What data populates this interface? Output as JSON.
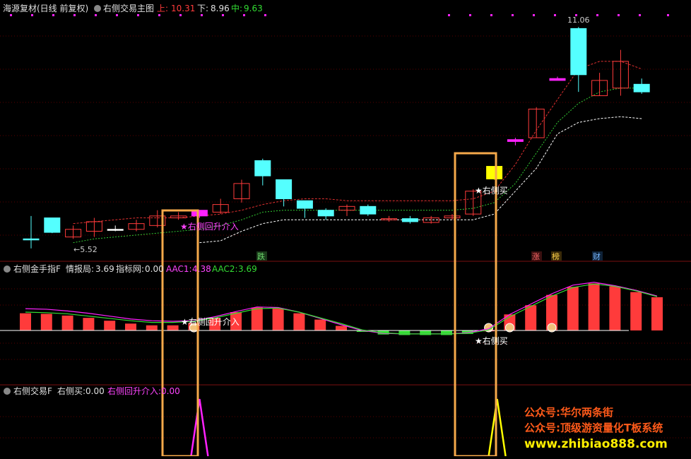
{
  "main_panel": {
    "title": "海源复材(日线 前复权)",
    "indicator_name": "右侧交易主图",
    "up_label": "上:",
    "up_value": "10.31",
    "down_label": "下:",
    "down_value": "8.96",
    "mid_label": "中:",
    "mid_value": "9.63",
    "high_marker": "11.06",
    "low_marker": "←5.52",
    "signal_buy": "★右侧买",
    "signal_rebound": "★右侧回升介入",
    "tags": [
      {
        "text": "跌",
        "color": "#6ad36a"
      },
      {
        "text": "涨",
        "color": "#ff6a6a"
      },
      {
        "text": "榜",
        "color": "#ffd24a"
      },
      {
        "text": "财",
        "color": "#7ab8ff"
      }
    ]
  },
  "panel2": {
    "title": "右侧金手指F",
    "label1": "情报局:",
    "value1": "3.69",
    "label2": "指标网:",
    "value2": "0.00",
    "label3": "AAC1:",
    "value3": "4.38",
    "label4": "AAC2:",
    "value4": "3.69",
    "signal_rebound": "★右侧回升介入",
    "signal_buy": "★右侧买"
  },
  "panel3": {
    "title": "右侧交易F",
    "label1": "右侧买:",
    "value1": "0.00",
    "label2": "右侧回升介入:",
    "value2": "0.00"
  },
  "watermark": {
    "line1": "公众号:华尔两条街",
    "line2": "公众号:顶级游资量化T板系统",
    "line3": "www.zhibiao888.com"
  },
  "colors": {
    "up": "#ff3b3b",
    "down": "#54ffff",
    "magenta": "#ff22ff",
    "yellow": "#ffff00",
    "highlight_box": "#f5a94a",
    "green_line": "#33dd33"
  },
  "chart_data": [
    {
      "type": "candlestick",
      "title": "右侧交易主图",
      "ylim": [
        5.0,
        11.4
      ],
      "candles": [
        {
          "o": 5.55,
          "h": 6.15,
          "l": 5.3,
          "c": 5.55,
          "dir": "down"
        },
        {
          "o": 6.1,
          "h": 6.1,
          "l": 5.7,
          "c": 5.72,
          "dir": "down"
        },
        {
          "o": 5.6,
          "h": 5.9,
          "l": 5.55,
          "c": 5.8,
          "dir": "up"
        },
        {
          "o": 5.75,
          "h": 6.1,
          "l": 5.6,
          "c": 6.0,
          "dir": "up"
        },
        {
          "o": 5.8,
          "h": 5.9,
          "l": 5.75,
          "c": 5.8,
          "dir": "flat"
        },
        {
          "o": 5.8,
          "h": 6.05,
          "l": 5.75,
          "c": 5.95,
          "dir": "up"
        },
        {
          "o": 5.9,
          "h": 6.3,
          "l": 5.85,
          "c": 6.15,
          "dir": "up"
        },
        {
          "o": 6.1,
          "h": 6.25,
          "l": 6.05,
          "c": 6.15,
          "dir": "up"
        },
        {
          "o": 6.3,
          "h": 6.3,
          "l": 6.1,
          "c": 6.15,
          "dir": "magenta"
        },
        {
          "o": 6.25,
          "h": 6.6,
          "l": 6.2,
          "c": 6.45,
          "dir": "up"
        },
        {
          "o": 6.6,
          "h": 7.1,
          "l": 6.5,
          "c": 7.0,
          "dir": "up"
        },
        {
          "o": 7.6,
          "h": 7.65,
          "l": 6.95,
          "c": 7.2,
          "dir": "down"
        },
        {
          "o": 7.1,
          "h": 7.1,
          "l": 6.4,
          "c": 6.6,
          "dir": "down"
        },
        {
          "o": 6.55,
          "h": 6.55,
          "l": 6.1,
          "c": 6.35,
          "dir": "down"
        },
        {
          "o": 6.3,
          "h": 6.35,
          "l": 6.05,
          "c": 6.15,
          "dir": "down"
        },
        {
          "o": 6.3,
          "h": 6.45,
          "l": 6.15,
          "c": 6.4,
          "dir": "up"
        },
        {
          "o": 6.4,
          "h": 6.45,
          "l": 6.15,
          "c": 6.2,
          "dir": "down"
        },
        {
          "o": 6.05,
          "h": 6.15,
          "l": 6.0,
          "c": 6.08,
          "dir": "up"
        },
        {
          "o": 6.08,
          "h": 6.15,
          "l": 5.95,
          "c": 6.0,
          "dir": "down"
        },
        {
          "o": 5.98,
          "h": 6.15,
          "l": 5.95,
          "c": 6.1,
          "dir": "up"
        },
        {
          "o": 6.1,
          "h": 6.2,
          "l": 6.05,
          "c": 6.15,
          "dir": "up"
        },
        {
          "o": 6.2,
          "h": 6.85,
          "l": 6.15,
          "c": 6.8,
          "dir": "up"
        },
        {
          "o": 7.12,
          "h": 7.45,
          "l": 7.1,
          "c": 7.45,
          "dir": "yellow"
        },
        {
          "o": 8.1,
          "h": 8.2,
          "l": 8.0,
          "c": 8.15,
          "dir": "magenta"
        },
        {
          "o": 8.2,
          "h": 9.0,
          "l": 8.2,
          "c": 8.95,
          "dir": "up"
        },
        {
          "o": 9.7,
          "h": 9.8,
          "l": 9.7,
          "c": 9.75,
          "dir": "magenta"
        },
        {
          "o": 11.06,
          "h": 11.1,
          "l": 9.4,
          "c": 9.85,
          "dir": "down"
        },
        {
          "o": 9.3,
          "h": 9.9,
          "l": 9.3,
          "c": 9.7,
          "dir": "up"
        },
        {
          "o": 9.5,
          "h": 10.5,
          "l": 9.3,
          "c": 10.2,
          "dir": "up"
        },
        {
          "o": 9.6,
          "h": 9.75,
          "l": 9.35,
          "c": 9.4,
          "dir": "down"
        }
      ],
      "upper_band": [
        null,
        null,
        5.95,
        6.0,
        6.05,
        6.1,
        6.1,
        6.1,
        6.15,
        6.2,
        6.3,
        6.45,
        6.55,
        6.6,
        6.6,
        6.55,
        6.55,
        6.55,
        6.55,
        6.55,
        6.55,
        6.6,
        6.8,
        7.5,
        8.4,
        9.2,
        10.0,
        10.2,
        10.2,
        10.0
      ],
      "middle_band": [
        null,
        null,
        5.45,
        5.55,
        5.6,
        5.65,
        5.7,
        5.75,
        5.8,
        5.9,
        6.05,
        6.25,
        6.3,
        6.3,
        6.3,
        6.3,
        6.3,
        6.3,
        6.3,
        6.3,
        6.3,
        6.35,
        6.5,
        7.0,
        7.8,
        8.6,
        9.1,
        9.4,
        9.5,
        9.5
      ],
      "lower_band": [
        null,
        null,
        null,
        null,
        null,
        null,
        null,
        null,
        5.45,
        5.5,
        5.75,
        5.95,
        6.05,
        6.05,
        6.05,
        6.05,
        6.05,
        6.05,
        6.05,
        6.05,
        6.05,
        6.05,
        6.2,
        6.8,
        7.4,
        8.3,
        8.6,
        8.7,
        8.75,
        8.7
      ]
    },
    {
      "type": "bar",
      "title": "右侧金手指F",
      "ylim": [
        -0.6,
        4.8
      ],
      "values": [
        1.5,
        1.45,
        1.3,
        1.1,
        0.85,
        0.6,
        0.45,
        0.45,
        0.65,
        1.1,
        1.6,
        2.0,
        1.9,
        1.5,
        0.95,
        0.4,
        -0.1,
        -0.35,
        -0.4,
        -0.4,
        -0.4,
        -0.3,
        0.05,
        1.4,
        2.2,
        3.1,
        3.8,
        4.1,
        3.85,
        3.35,
        2.9
      ],
      "signals": [
        0,
        0,
        0,
        0,
        0,
        0,
        0,
        0,
        1,
        0,
        0,
        0,
        0,
        0,
        0,
        0,
        0,
        0,
        0,
        0,
        0,
        0,
        1,
        1,
        0,
        1,
        0,
        0,
        0,
        0,
        0
      ],
      "aac1": [
        1.9,
        1.85,
        1.7,
        1.5,
        1.25,
        1.0,
        0.85,
        0.8,
        0.85,
        1.2,
        1.65,
        2.05,
        2.0,
        1.6,
        1.05,
        0.5,
        0.0,
        -0.25,
        -0.3,
        -0.3,
        -0.3,
        -0.2,
        0.15,
        1.4,
        2.3,
        3.2,
        3.95,
        4.2,
        3.9,
        3.5,
        3.0
      ],
      "aac2": [
        1.6,
        1.55,
        1.45,
        1.25,
        1.05,
        0.85,
        0.7,
        0.7,
        0.8,
        1.1,
        1.5,
        1.9,
        1.95,
        1.6,
        1.1,
        0.6,
        0.05,
        -0.2,
        -0.3,
        -0.3,
        -0.3,
        -0.25,
        0.05,
        1.2,
        2.1,
        3.0,
        3.75,
        4.05,
        3.85,
        3.45,
        2.95
      ]
    },
    {
      "type": "line",
      "title": "右侧交易F",
      "ylim": [
        0,
        1
      ],
      "spikes": [
        {
          "index": 8,
          "series": "右侧回升介入",
          "value": 1
        },
        {
          "index": 22,
          "series": "右侧买",
          "value": 1
        }
      ]
    }
  ]
}
